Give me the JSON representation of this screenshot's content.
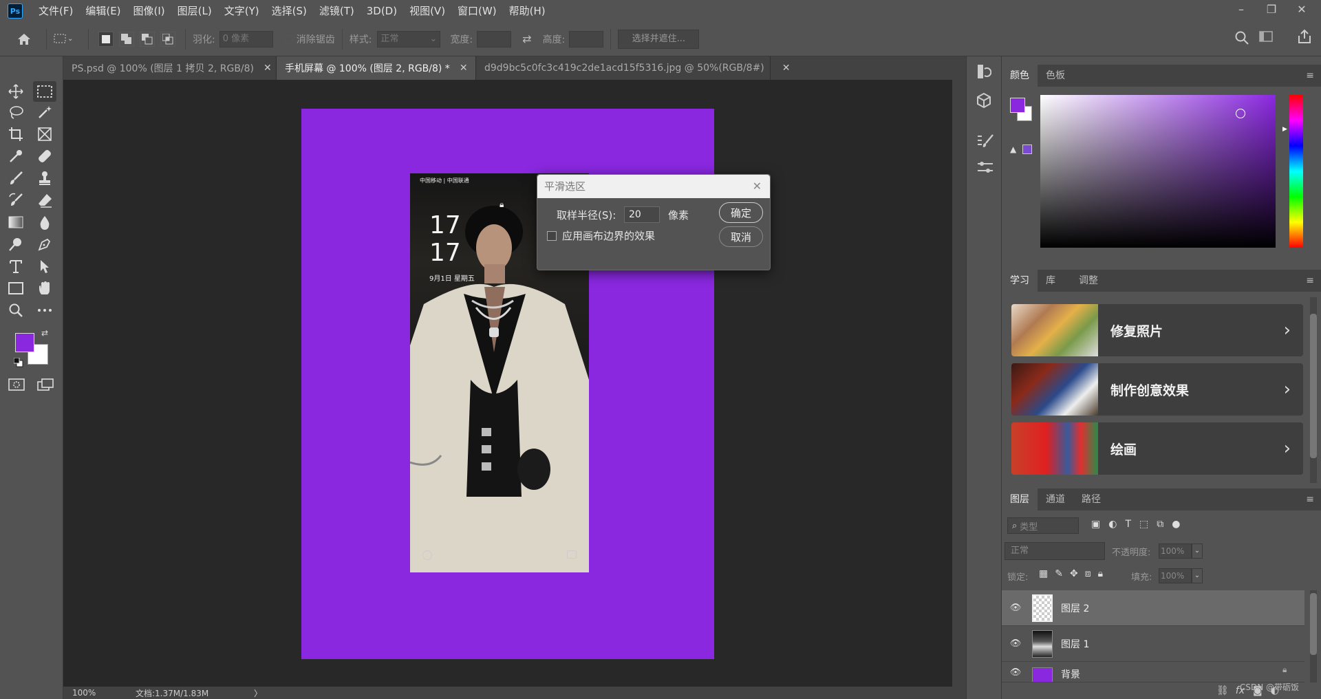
{
  "app": {
    "logo": "Ps",
    "menus": [
      "文件(F)",
      "编辑(E)",
      "图像(I)",
      "图层(L)",
      "文字(Y)",
      "选择(S)",
      "滤镜(T)",
      "3D(D)",
      "视图(V)",
      "窗口(W)",
      "帮助(H)"
    ]
  },
  "options_bar": {
    "feather_label": "羽化:",
    "feather_placeholder": "0 像素",
    "antialias_label": "消除锯齿",
    "style_label": "样式:",
    "style_value": "正常",
    "width_label": "宽度:",
    "height_label": "高度:",
    "select_mask_label": "选择并遮住..."
  },
  "tabs": [
    {
      "label": "PS.psd @ 100% (图层 1 拷贝 2, RGB/8)",
      "active": false
    },
    {
      "label": "手机屏幕 @ 100% (图层 2, RGB/8) *",
      "active": true
    },
    {
      "label": "d9d9bc5c0fc3c419c2de1acd15f5316.jpg @ 50%(RGB/8#)",
      "active": false
    }
  ],
  "phone_screen": {
    "carrier": "中国移动 | 中国联通",
    "hour": "17",
    "minute": "17",
    "date": "9月1日  星期五"
  },
  "status_bar": {
    "zoom": "100%",
    "doc_size": "文档:1.37M/1.83M",
    "arrow": "〉"
  },
  "dialog": {
    "title": "平滑选区",
    "radius_label": "取样半径(S):",
    "radius_value": "20",
    "unit": "像素",
    "checkbox_label": "应用画布边界的效果",
    "ok_label": "确定",
    "cancel_label": "取消"
  },
  "color_panel": {
    "tabs": [
      "颜色",
      "色板"
    ],
    "foreground_color": "#8a28e0",
    "background_color": "#ffffff"
  },
  "learn_panel": {
    "tabs": [
      "学习",
      "库",
      "调整"
    ],
    "cards": [
      {
        "label": "修复照片"
      },
      {
        "label": "制作创意效果"
      },
      {
        "label": "绘画"
      }
    ]
  },
  "layers_panel": {
    "tabs": [
      "图层",
      "通道",
      "路径"
    ],
    "filter_placeholder": "类型",
    "blend_mode": "正常",
    "opacity_label": "不透明度:",
    "opacity_value": "100%",
    "lock_label": "锁定:",
    "fill_label": "填充:",
    "fill_value": "100%",
    "layers": [
      {
        "name": "图层 2",
        "active": true
      },
      {
        "name": "图层 1",
        "active": false
      },
      {
        "name": "背景",
        "active": false
      }
    ],
    "fx_label": "fx",
    "watermark": "CSDN @带砺饭"
  }
}
